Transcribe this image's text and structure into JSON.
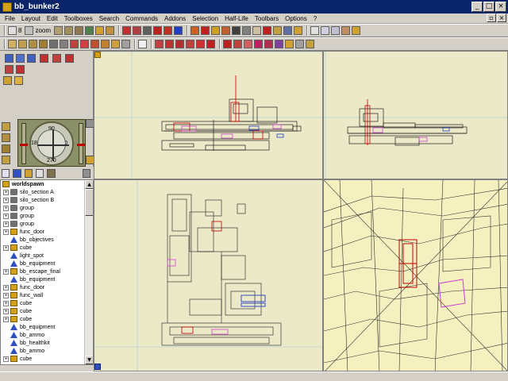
{
  "window": {
    "title": "bb_bunker2",
    "minimize_glyph": "_",
    "maximize_glyph": "□",
    "close_glyph": "×"
  },
  "menu": {
    "items": [
      "File",
      "Layout",
      "Edit",
      "Toolboxes",
      "Search",
      "Commands",
      "Addons",
      "Selection",
      "Half-Life",
      "Toolbars",
      "Options",
      "?"
    ],
    "doc_restore_glyph": "▫",
    "doc_close_glyph": "×"
  },
  "toolbar": {
    "grid_value": "8",
    "zoom_label": "zoom"
  },
  "compass": {
    "north": "90",
    "south": "270",
    "west": "180",
    "east": "0"
  },
  "tree": {
    "root": "worldspawn",
    "items": [
      {
        "label": "silo_section A",
        "type": "group",
        "expandable": true
      },
      {
        "label": "silo_section B",
        "type": "group",
        "expandable": true
      },
      {
        "label": "group",
        "type": "group",
        "expandable": true
      },
      {
        "label": "group",
        "type": "group",
        "expandable": true
      },
      {
        "label": "group",
        "type": "group",
        "expandable": true
      },
      {
        "label": "func_door",
        "type": "cube",
        "expandable": true
      },
      {
        "label": "bb_objectives",
        "type": "entity",
        "expandable": false
      },
      {
        "label": "cube",
        "type": "cube",
        "expandable": true
      },
      {
        "label": "light_spot",
        "type": "entity",
        "expandable": false
      },
      {
        "label": "bb_equipment",
        "type": "entity",
        "expandable": false
      },
      {
        "label": "bb_escape_final",
        "type": "cube",
        "expandable": true
      },
      {
        "label": "bb_equipment",
        "type": "entity",
        "expandable": false
      },
      {
        "label": "func_door",
        "type": "cube",
        "expandable": true
      },
      {
        "label": "func_wall",
        "type": "cube",
        "expandable": true
      },
      {
        "label": "cube",
        "type": "cube",
        "expandable": true
      },
      {
        "label": "cube",
        "type": "cube",
        "expandable": true
      },
      {
        "label": "cube",
        "type": "cube",
        "expandable": true
      },
      {
        "label": "bb_equipment",
        "type": "entity",
        "expandable": false
      },
      {
        "label": "bb_ammo",
        "type": "entity",
        "expandable": false
      },
      {
        "label": "bb_healthkit",
        "type": "entity",
        "expandable": false
      },
      {
        "label": "bb_ammo",
        "type": "entity",
        "expandable": false
      },
      {
        "label": "cube",
        "type": "cube",
        "expandable": true
      }
    ],
    "expand_glyph": "+",
    "scroll_up_glyph": "▲",
    "scroll_down_glyph": "▼"
  },
  "colors": {
    "titlebar": "#0a246a",
    "viewport_bg": "#ece9c8",
    "wire_dark": "#202020",
    "wire_red": "#c00000",
    "wire_magenta": "#d040d0",
    "wire_blue": "#2040c0"
  }
}
